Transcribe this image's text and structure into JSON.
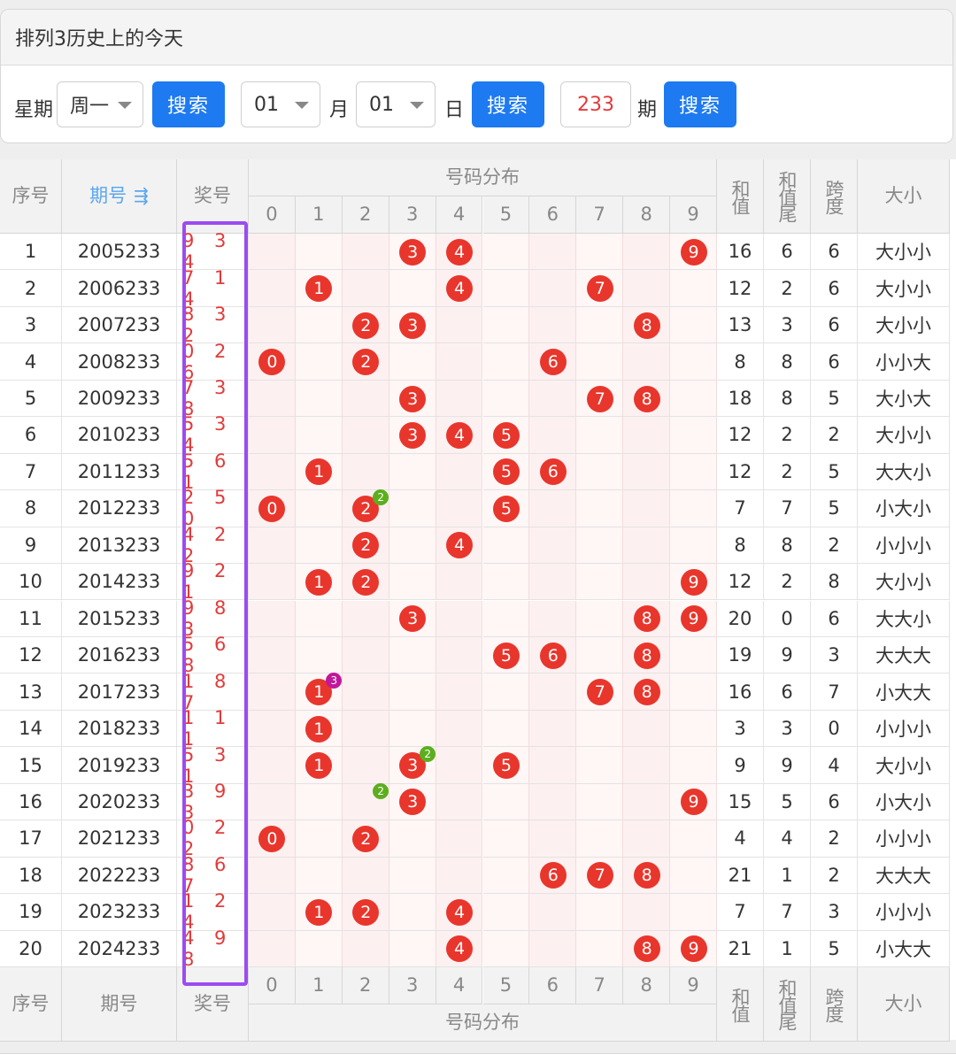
{
  "page": {
    "title": "排列3历史上的今天"
  },
  "search": {
    "weekday_label": "星期",
    "weekday_value": "周一",
    "search_label": "搜索",
    "month_value": "01",
    "month_label": "月",
    "day_value": "01",
    "day_label": "日",
    "issue_value": "233",
    "issue_label": "期"
  },
  "table": {
    "headers": {
      "index": "序号",
      "issue": "期号",
      "sort_icon": "⇶",
      "winning": "奖号",
      "distribution": "号码分布",
      "sum": "和值",
      "sum_tail": "和值尾",
      "span": "跨度",
      "size": "大小"
    },
    "digits": [
      "0",
      "1",
      "2",
      "3",
      "4",
      "5",
      "6",
      "7",
      "8",
      "9"
    ],
    "rows": [
      {
        "idx": "1",
        "issue": "2005233",
        "num": "9 3 4",
        "sum": "16",
        "tail": "6",
        "span": "6",
        "size": "大小小"
      },
      {
        "idx": "2",
        "issue": "2006233",
        "num": "7 1 4",
        "sum": "12",
        "tail": "2",
        "span": "6",
        "size": "大小小"
      },
      {
        "idx": "3",
        "issue": "2007233",
        "num": "8 3 2",
        "sum": "13",
        "tail": "3",
        "span": "6",
        "size": "大小小"
      },
      {
        "idx": "4",
        "issue": "2008233",
        "num": "0 2 6",
        "sum": "8",
        "tail": "8",
        "span": "6",
        "size": "小小大"
      },
      {
        "idx": "5",
        "issue": "2009233",
        "num": "7 3 8",
        "sum": "18",
        "tail": "8",
        "span": "5",
        "size": "大小大"
      },
      {
        "idx": "6",
        "issue": "2010233",
        "num": "5 3 4",
        "sum": "12",
        "tail": "2",
        "span": "2",
        "size": "大小小"
      },
      {
        "idx": "7",
        "issue": "2011233",
        "num": "5 6 1",
        "sum": "12",
        "tail": "2",
        "span": "5",
        "size": "大大小"
      },
      {
        "idx": "8",
        "issue": "2012233",
        "num": "2 5 0",
        "sum": "7",
        "tail": "7",
        "span": "5",
        "size": "小大小"
      },
      {
        "idx": "9",
        "issue": "2013233",
        "num": "4 2 2",
        "sum": "8",
        "tail": "8",
        "span": "2",
        "size": "小小小"
      },
      {
        "idx": "10",
        "issue": "2014233",
        "num": "9 2 1",
        "sum": "12",
        "tail": "2",
        "span": "8",
        "size": "大小小"
      },
      {
        "idx": "11",
        "issue": "2015233",
        "num": "9 8 3",
        "sum": "20",
        "tail": "0",
        "span": "6",
        "size": "大大小"
      },
      {
        "idx": "12",
        "issue": "2016233",
        "num": "5 6 8",
        "sum": "19",
        "tail": "9",
        "span": "3",
        "size": "大大大"
      },
      {
        "idx": "13",
        "issue": "2017233",
        "num": "1 8 7",
        "sum": "16",
        "tail": "6",
        "span": "7",
        "size": "小大大"
      },
      {
        "idx": "14",
        "issue": "2018233",
        "num": "1 1 1",
        "sum": "3",
        "tail": "3",
        "span": "0",
        "size": "小小小"
      },
      {
        "idx": "15",
        "issue": "2019233",
        "num": "5 3 1",
        "sum": "9",
        "tail": "9",
        "span": "4",
        "size": "大小小"
      },
      {
        "idx": "16",
        "issue": "2020233",
        "num": "3 9 3",
        "sum": "15",
        "tail": "5",
        "span": "6",
        "size": "小大小"
      },
      {
        "idx": "17",
        "issue": "2021233",
        "num": "0 2 2",
        "sum": "4",
        "tail": "4",
        "span": "2",
        "size": "小小小"
      },
      {
        "idx": "18",
        "issue": "2022233",
        "num": "8 6 7",
        "sum": "21",
        "tail": "1",
        "span": "2",
        "size": "大大大"
      },
      {
        "idx": "19",
        "issue": "2023233",
        "num": "1 2 4",
        "sum": "7",
        "tail": "7",
        "span": "3",
        "size": "小小小"
      },
      {
        "idx": "20",
        "issue": "2024233",
        "num": "4 9 8",
        "sum": "21",
        "tail": "1",
        "span": "5",
        "size": "小大大"
      }
    ],
    "balls": [
      [
        "3",
        "4",
        "9"
      ],
      [
        "1",
        "4",
        "7"
      ],
      [
        "2",
        "3",
        "8"
      ],
      [
        "0",
        "2",
        "6"
      ],
      [
        "3",
        "7",
        "8"
      ],
      [
        "3",
        "4",
        "5"
      ],
      [
        "1",
        "5",
        "6"
      ],
      [
        "0",
        "2",
        "5"
      ],
      [
        "2",
        "4"
      ],
      [
        "1",
        "2",
        "9"
      ],
      [
        "3",
        "8",
        "9"
      ],
      [
        "5",
        "6",
        "8"
      ],
      [
        "1",
        "7",
        "8"
      ],
      [
        "1"
      ],
      [
        "1",
        "3",
        "5"
      ],
      [
        "3",
        "9"
      ],
      [
        "0",
        "2"
      ],
      [
        "6",
        "7",
        "8"
      ],
      [
        "1",
        "2",
        "4"
      ],
      [
        "4",
        "8",
        "9"
      ]
    ],
    "repeat_badges": [
      {
        "row": 8,
        "digit": "2",
        "count": "2",
        "color": "#5cae1e"
      },
      {
        "row": 13,
        "digit": "1",
        "count": "3",
        "color": "#c0189a"
      },
      {
        "row": 15,
        "digit": "3",
        "count": "2",
        "color": "#5cae1e"
      },
      {
        "row": 16,
        "digit": "2",
        "count": "2",
        "color": "#5cae1e"
      }
    ],
    "colors": {
      "ball": "#e8362c",
      "highlight": "#9b4cf0",
      "accent": "#1e7af0",
      "stripe": "#fdeeee"
    }
  },
  "footer": {
    "index": "序号",
    "issue": "期号",
    "winning": "奖号",
    "distribution": "号码分布",
    "sum": "和值",
    "sum_tail": "和值尾",
    "span": "跨度",
    "size": "大小"
  }
}
